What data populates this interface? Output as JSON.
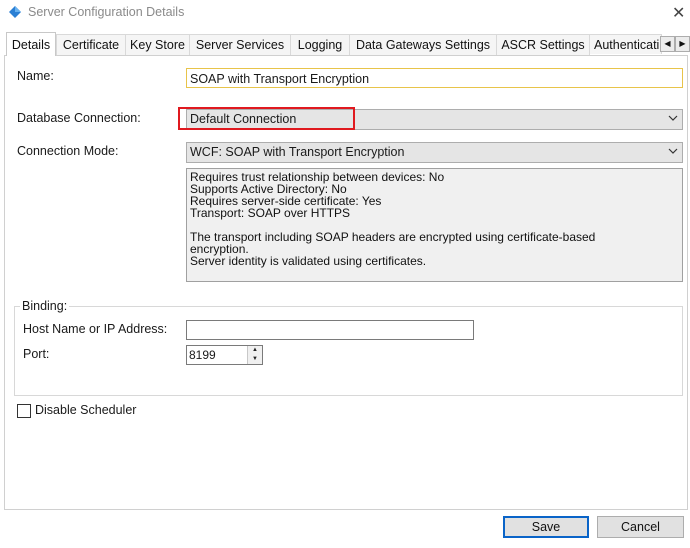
{
  "window": {
    "title": "Server Configuration Details",
    "close_glyph": "✕"
  },
  "tabs": [
    {
      "label": "Details",
      "active": true
    },
    {
      "label": "Certificate"
    },
    {
      "label": "Key Store"
    },
    {
      "label": "Server Services"
    },
    {
      "label": "Logging"
    },
    {
      "label": "Data Gateways Settings"
    },
    {
      "label": "ASCR Settings"
    },
    {
      "label": "Authenticati"
    }
  ],
  "tab_scroll": {
    "left_glyph": "◀",
    "right_glyph": "▶"
  },
  "form": {
    "name_label": "Name:",
    "name_value": "SOAP with Transport Encryption",
    "db_label": "Database Connection:",
    "db_value": "Default Connection",
    "mode_label": "Connection Mode:",
    "mode_value": "WCF: SOAP with Transport Encryption",
    "description_lines": [
      "Requires trust relationship between devices: No",
      "Supports Active Directory: No",
      "Requires server-side certificate: Yes",
      "Transport: SOAP over HTTPS",
      "",
      "The transport including SOAP headers are encrypted using certificate-based",
      "encryption.",
      "Server identity is validated using certificates."
    ]
  },
  "binding": {
    "group_label": "Binding:",
    "host_label": "Host Name or IP Address:",
    "host_value": "",
    "port_label": "Port:",
    "port_value": "8199"
  },
  "scheduler": {
    "label": "Disable Scheduler",
    "checked": false
  },
  "buttons": {
    "save": "Save",
    "cancel": "Cancel"
  },
  "colors": {
    "highlight": "#e0191f",
    "default_button_border": "#0a64c8",
    "focus_border": "#e8c44a"
  },
  "icons": {
    "app": "blue-diamond-icon",
    "dropdown": "chevron-down-icon"
  }
}
